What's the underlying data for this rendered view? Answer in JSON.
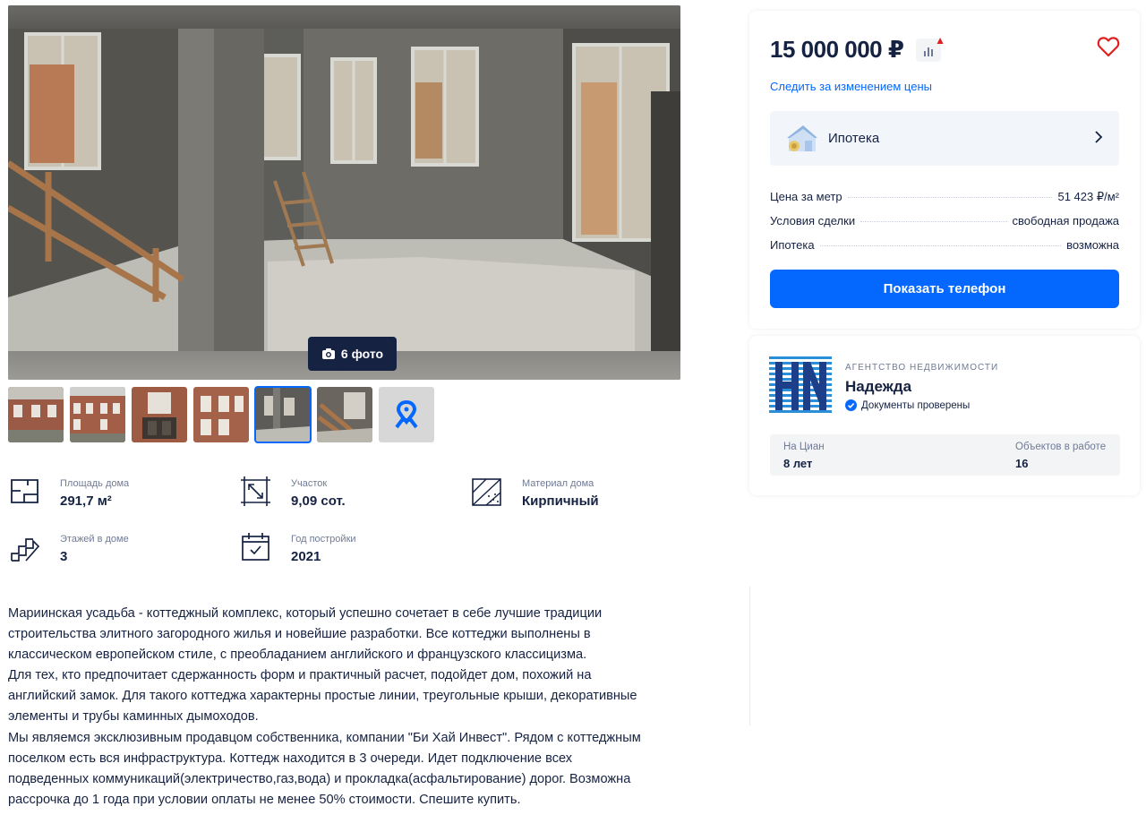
{
  "gallery": {
    "photo_count": "6 фото",
    "thumbnails": [
      "photo-1",
      "photo-2",
      "photo-3",
      "photo-4",
      "photo-5",
      "photo-6"
    ],
    "active_thumbnail": 5,
    "map_icon": "map-pin-icon"
  },
  "features": [
    {
      "icon": "house-area-icon",
      "label": "Площадь дома",
      "value": "291,7 м²"
    },
    {
      "icon": "plot-icon",
      "label": "Участок",
      "value": "9,09 сот."
    },
    {
      "icon": "material-icon",
      "label": "Материал дома",
      "value": "Кирпичный"
    },
    {
      "icon": "stairs-icon",
      "label": "Этажей в доме",
      "value": "3"
    },
    {
      "icon": "calendar-icon",
      "label": "Год постройки",
      "value": "2021"
    }
  ],
  "description": [
    "Мариинская усадьба - коттеджный комплекс, который успешно сочетает в себе лучшие традиции",
    "строительства элитного загородного жилья и новейшие разработки. Все коттеджи выполнены в",
    "классическом европейском стиле, с преобладанием английского и французского классицизма.",
    "Для тех, кто предпочитает сдержанность форм и практичный расчет, подойдет дом, похожий на",
    "английский замок. Для такого коттеджа характерны простые линии, треугольные крыши, декоративные",
    "элементы и трубы каминных дымоходов.",
    "Мы являемся эксклюзивным продавцом собственника, компании \"Би Хай Инвест\".  Рядом с коттеджным",
    "поселком есть вся инфраструктура. Коттедж находится в 3 очереди. Идет подключение всех",
    "подведенных коммуникаций(электричество,газ,вода) и прокладка(асфальтирование) дорог. Возможна",
    "рассрочка до 1 года при условии оплаты не менее 50% стоимости.  Спешите купить."
  ],
  "price_card": {
    "price": "15 000 000 ₽",
    "track_link": "Следить за изменением цены",
    "mortgage_label": "Ипотека",
    "facts": [
      {
        "label": "Цена за метр",
        "value": "51 423 ₽/м²"
      },
      {
        "label": "Условия сделки",
        "value": "свободная продажа"
      },
      {
        "label": "Ипотека",
        "value": "возможна"
      }
    ],
    "phone_button": "Показать телефон",
    "colors": {
      "accent": "#0468ff",
      "heart": "#e02020"
    }
  },
  "agency": {
    "type": "АГЕНТСТВО НЕДВИЖИМОСТИ",
    "name": "Надежда",
    "verified": "Документы проверены",
    "stats": [
      {
        "label": "На Циан",
        "value": "8 лет"
      },
      {
        "label": "Объектов в работе",
        "value": "16"
      }
    ]
  }
}
